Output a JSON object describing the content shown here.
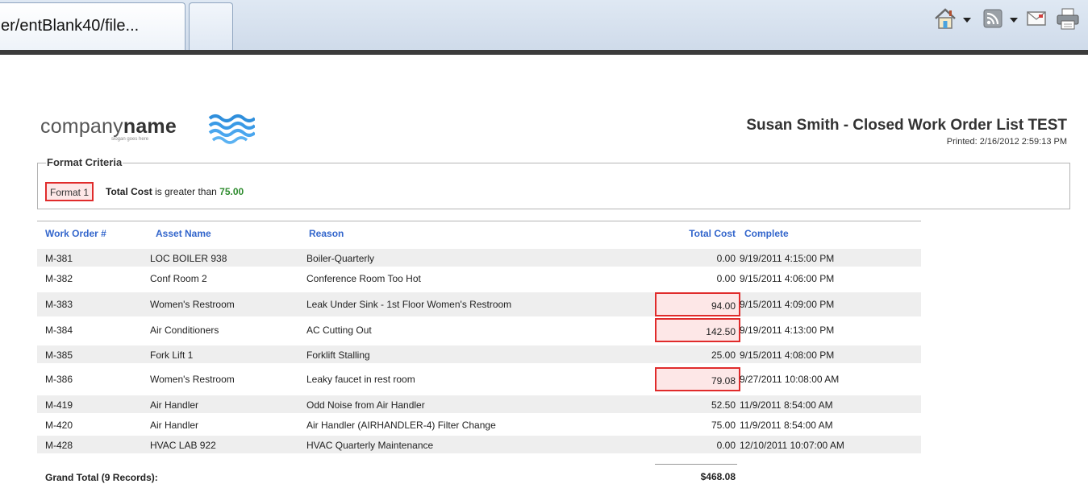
{
  "browser": {
    "tab_title": "er/entBlank40/file..."
  },
  "toolbar": {
    "icons": [
      "home-icon",
      "feeds-icon",
      "read-mail-icon",
      "print-icon"
    ]
  },
  "report": {
    "logo": {
      "name_light": "company",
      "name_bold": "name",
      "slogan": "slogan goes here"
    },
    "title": "Susan Smith - Closed Work Order List TEST",
    "printed": "Printed: 2/16/2012 2:59:13 PM",
    "criteria": {
      "legend": "Format Criteria",
      "format_label": "Format 1",
      "field": "Total Cost",
      "operator_text": " is greater than ",
      "value": "75.00",
      "highlight_color": "#e02b2b"
    },
    "columns": [
      "Work Order #",
      "Asset Name",
      "Reason",
      "Total Cost",
      "Complete"
    ],
    "rows": [
      {
        "wo": "M-381",
        "asset": "LOC BOILER 938",
        "reason": "Boiler-Quarterly",
        "cost": "0.00",
        "complete": "9/19/2011 4:15:00 PM",
        "highlight": false
      },
      {
        "wo": "M-382",
        "asset": "Conf Room 2",
        "reason": "Conference Room Too Hot",
        "cost": "0.00",
        "complete": "9/15/2011 4:06:00 PM",
        "highlight": false
      },
      {
        "wo": "M-383",
        "asset": "Women's Restroom",
        "reason": "Leak Under Sink - 1st Floor Women's Restroom",
        "cost": "94.00",
        "complete": "9/15/2011 4:09:00 PM",
        "highlight": true
      },
      {
        "wo": "M-384",
        "asset": "Air Conditioners",
        "reason": "AC Cutting Out",
        "cost": "142.50",
        "complete": "9/19/2011 4:13:00 PM",
        "highlight": true
      },
      {
        "wo": "M-385",
        "asset": "Fork Lift 1",
        "reason": "Forklift Stalling",
        "cost": "25.00",
        "complete": "9/15/2011 4:08:00 PM",
        "highlight": false
      },
      {
        "wo": "M-386",
        "asset": "Women's Restroom",
        "reason": "Leaky faucet in rest room",
        "cost": "79.08",
        "complete": "9/27/2011 10:08:00 AM",
        "highlight": true
      },
      {
        "wo": "M-419",
        "asset": "Air Handler",
        "reason": "Odd Noise from Air Handler",
        "cost": "52.50",
        "complete": "11/9/2011 8:54:00 AM",
        "highlight": false
      },
      {
        "wo": "M-420",
        "asset": "Air Handler",
        "reason": "Air Handler (AIRHANDLER-4) Filter Change",
        "cost": "75.00",
        "complete": "11/9/2011 8:54:00 AM",
        "highlight": false
      },
      {
        "wo": "M-428",
        "asset": "HVAC LAB 922",
        "reason": "HVAC Quarterly Maintenance",
        "cost": "0.00",
        "complete": "12/10/2011 10:07:00 AM",
        "highlight": false
      }
    ],
    "grand_total_label": "Grand Total (9 Records):",
    "grand_total_value": "$468.08"
  }
}
